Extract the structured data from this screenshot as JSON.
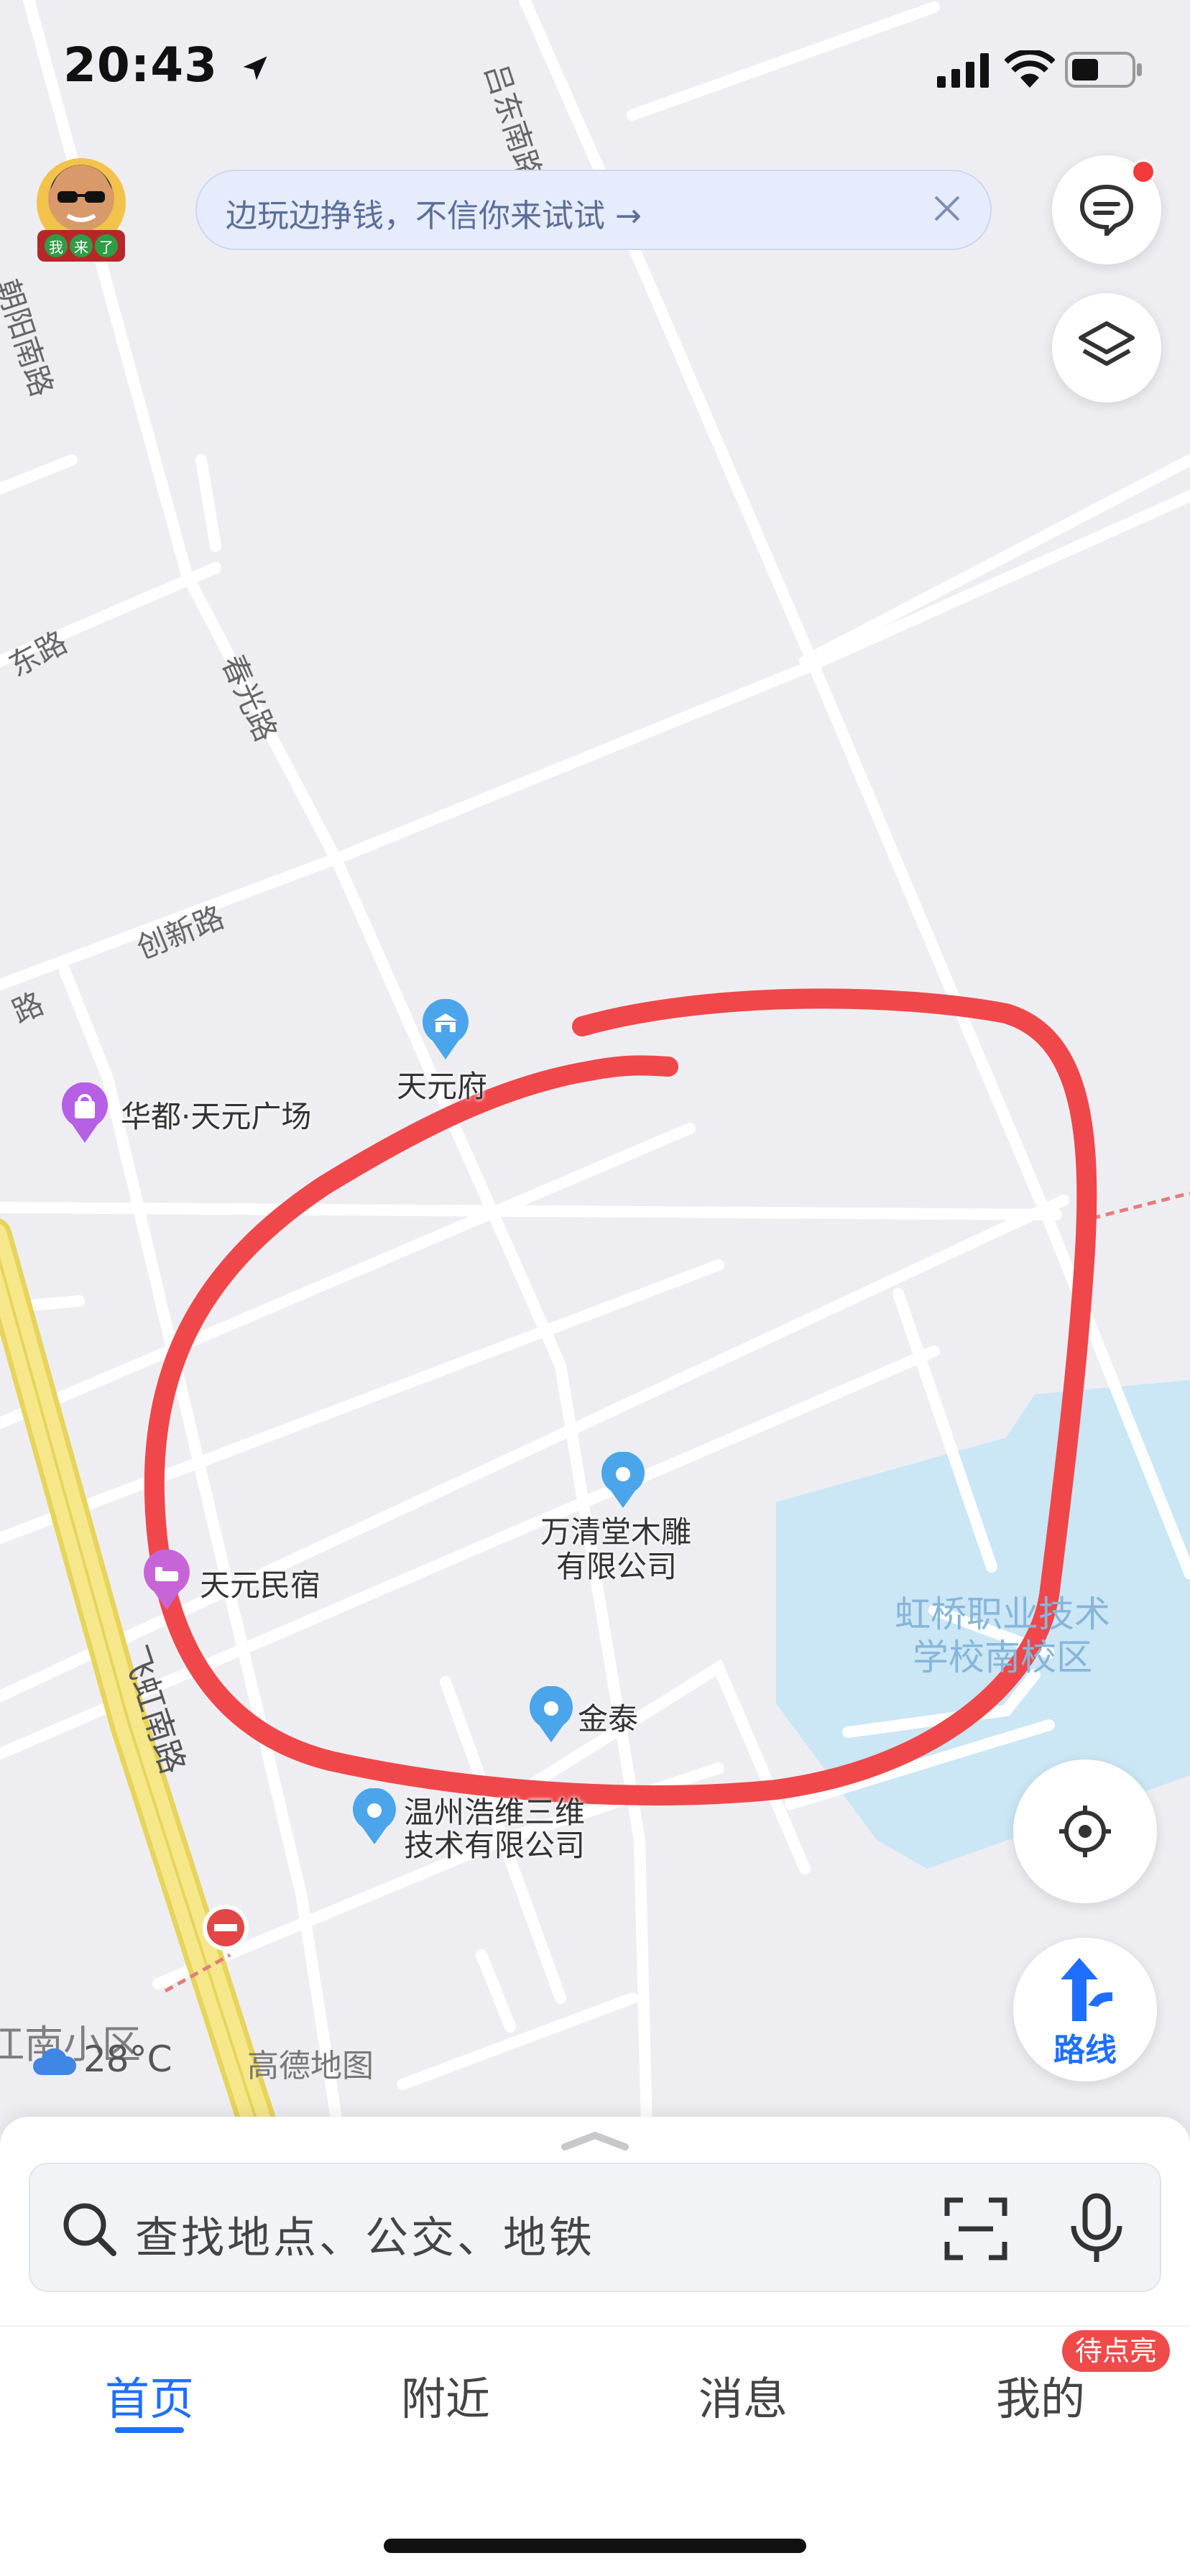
{
  "status_bar": {
    "time": "20:43"
  },
  "avatar": {
    "badge_chars": [
      "我",
      "来",
      "了"
    ]
  },
  "banner": {
    "text": "边玩边挣钱，不信你来试试 →",
    "close_icon": "close-icon"
  },
  "top_right_buttons": [
    {
      "icon": "message-icon",
      "has_dot": true
    },
    {
      "icon": "layers-icon"
    }
  ],
  "map": {
    "road_labels": [
      "吕东南路",
      "朝阳南路",
      "春光路",
      "创新路",
      "东路",
      "路",
      "飞虹南路"
    ],
    "pois": [
      {
        "name": "天元府",
        "icon": "government-icon"
      },
      {
        "name": "华都·天元广场",
        "icon": "shopping-icon"
      },
      {
        "name": "万清堂木雕",
        "name2": "有限公司",
        "icon": "location-pin-icon"
      },
      {
        "name": "天元民宿",
        "icon": "hotel-icon"
      },
      {
        "name": "金泰",
        "icon": "location-pin-icon"
      },
      {
        "name": "温州浩维三维",
        "name2": "技术有限公司",
        "icon": "location-pin-icon"
      },
      {
        "name": "虹桥职业技术",
        "name2": "学校南校区",
        "icon": "school-area"
      },
      {
        "name": "江南小区",
        "icon": "residential-label"
      }
    ],
    "weather": {
      "temp": "28°C",
      "icon": "cloud-icon"
    },
    "brand": "高德地图",
    "annotation": {
      "color": "#f0474b",
      "shape": "hand-drawn-circle"
    }
  },
  "right_controls": {
    "locate_icon": "locate-icon",
    "route_label": "路线"
  },
  "search": {
    "placeholder": "查找地点、公交、地铁"
  },
  "tabs": [
    {
      "label": "首页",
      "active": true
    },
    {
      "label": "附近",
      "active": false
    },
    {
      "label": "消息",
      "active": false
    },
    {
      "label": "我的",
      "active": false
    }
  ],
  "mine_badge": "待点亮",
  "colors": {
    "accent": "#1f6fff",
    "badge": "#ef4b4b",
    "map_bg": "#eeeef2",
    "main_road": "#f3e37a",
    "school_area": "#cbe6f5"
  }
}
